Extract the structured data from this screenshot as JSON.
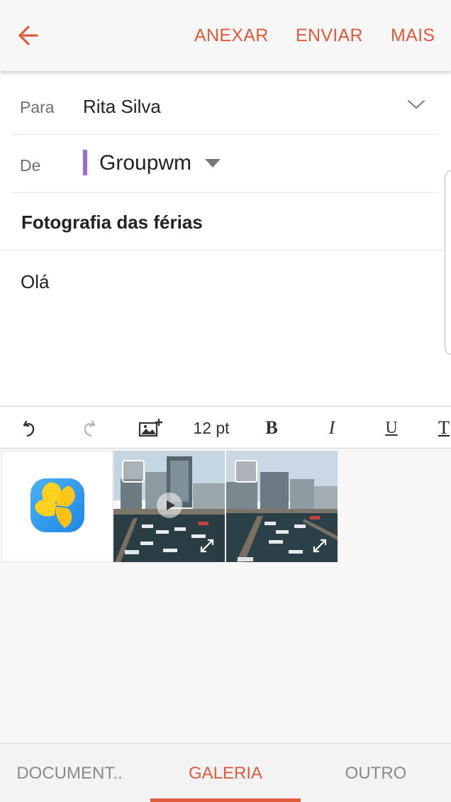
{
  "appbar": {
    "back_icon": "arrow-left-icon",
    "actions": {
      "attach": "ANEXAR",
      "send": "ENVIAR",
      "more": "MAIS"
    }
  },
  "compose": {
    "to_label": "Para",
    "to_value": "Rita Silva",
    "from_label": "De",
    "from_account": "Groupwm",
    "account_color": "#9a6bd3",
    "subject": "Fotografia das férias",
    "body": "Olá"
  },
  "toolbar": {
    "font_size": "12 pt",
    "bold": "B",
    "italic": "I",
    "underline": "U",
    "text_color": "T",
    "icons": [
      "undo-icon",
      "redo-icon",
      "insert-image-icon"
    ]
  },
  "gallery": {
    "items": [
      {
        "type": "app",
        "icon": "gallery-app-icon"
      },
      {
        "type": "video",
        "icon": "play-icon",
        "selected": false
      },
      {
        "type": "photo",
        "selected": false
      }
    ]
  },
  "tabs": {
    "items": [
      "DOCUMENT..",
      "GALERIA",
      "OUTRO"
    ],
    "active": "GALERIA"
  },
  "colors": {
    "accent": "#e05a3c",
    "appbar_bg": "#f7f7f7",
    "gallery_bg": "#f7f7f7"
  }
}
